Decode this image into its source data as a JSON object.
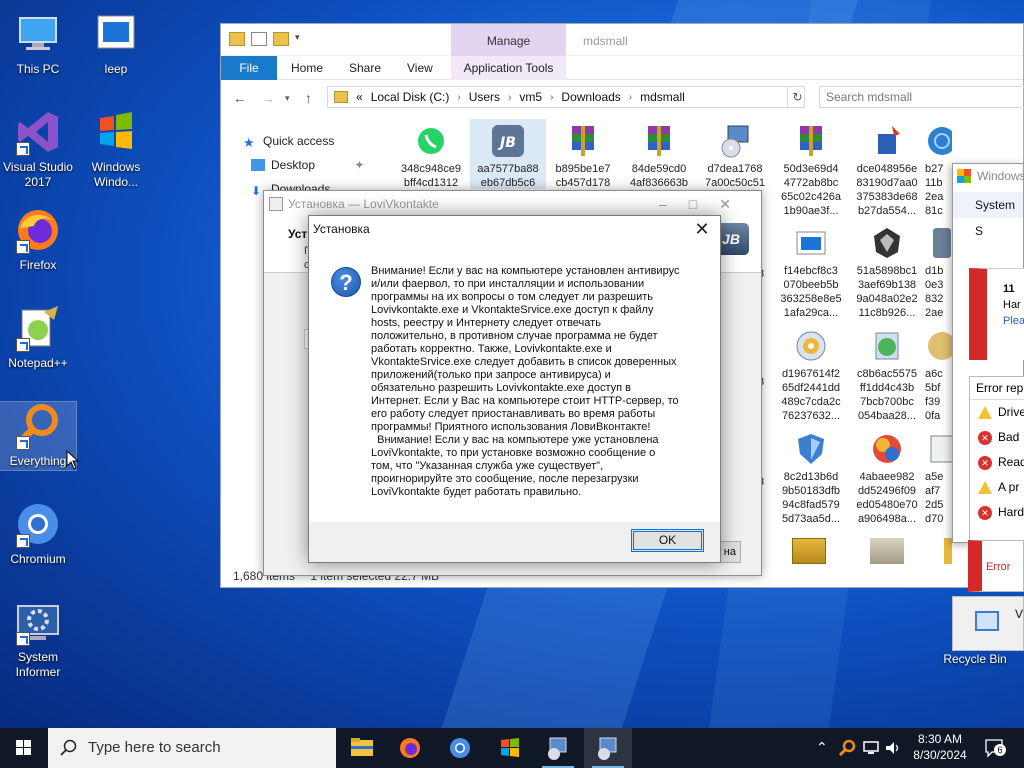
{
  "desktop": {
    "icons": [
      {
        "label": "This PC"
      },
      {
        "label": "leep"
      },
      {
        "label": "Visual Studio 2017"
      },
      {
        "label": "Windows Windo..."
      },
      {
        "label": "Firefox"
      },
      {
        "label": "Notepad++"
      },
      {
        "label": "Everything"
      },
      {
        "label": "Chromium"
      },
      {
        "label": "System Informer"
      },
      {
        "label": "Recycle Bin"
      }
    ]
  },
  "explorer": {
    "manage_tab": "Manage",
    "title": "mdsmall",
    "ribbon_tabs": [
      "File",
      "Home",
      "Share",
      "View",
      "Application Tools"
    ],
    "breadcrumb_prefix": "«",
    "breadcrumb": [
      "Local Disk (C:)",
      "Users",
      "vm5",
      "Downloads",
      "mdsmall"
    ],
    "search_placeholder": "Search mdsmall",
    "nav": {
      "quick_access": "Quick access",
      "desktop": "Desktop",
      "downloads": "Downloads"
    },
    "files": [
      {
        "l1": "348c948ce9",
        "l2": "bff4cd1312"
      },
      {
        "l1": "aa7577ba88",
        "l2": "eb67db5c6"
      },
      {
        "l1": "b895be1e7",
        "l2": "cb457d178"
      },
      {
        "l1": "84de59cd0",
        "l2": "4af836663b"
      },
      {
        "l1": "d7dea1768",
        "l2": "7a00c50c51"
      },
      {
        "l1": "50d3e69d4",
        "l2": "4772ab8bc",
        "l3": "65c02c426a",
        "l4": "1b90ae3f..."
      },
      {
        "l1": "dce048956e",
        "l2": "83190d7aa0",
        "l3": "375383de68",
        "l4": "b27da554..."
      },
      {
        "l1": "b27",
        "l2": "11b",
        "l3": "2ea",
        "l4": "81c"
      },
      {
        "l1": "f14ebcf8c3",
        "l2": "070beeb5b",
        "l3": "363258e8e5",
        "l4": "1afa29ca..."
      },
      {
        "l1": "51a5898bc1",
        "l2": "3aef69b138",
        "l3": "9a048a02e2",
        "l4": "11c8b926..."
      },
      {
        "l1": "d1b",
        "l2": "0e3",
        "l3": "832",
        "l4": "2ae"
      },
      {
        "l1": "d1967614f2",
        "l2": "65df2441dd",
        "l3": "489c7cda2c",
        "l4": "76237632..."
      },
      {
        "l1": "c8b6ac5575",
        "l2": "ff1dd4c43b",
        "l3": "7bcb700bc",
        "l4": "054baa28..."
      },
      {
        "l1": "a6c",
        "l2": "5bf",
        "l3": "f39",
        "l4": "0fa"
      },
      {
        "l1": "8c2d13b6d",
        "l2": "9b50183dfb",
        "l3": "94c8fad579",
        "l4": "5d73aa5d..."
      },
      {
        "l1": "4abaee982",
        "l2": "dd52496f09",
        "l3": "ed05480e70",
        "l4": "a906498a..."
      },
      {
        "l1": "a5e",
        "l2": "af7",
        "l3": "2d5",
        "l4": "d70"
      }
    ],
    "partial_cols": [
      "3",
      "8",
      "3",
      "a"
    ],
    "status": {
      "items": "1,680 items",
      "selected": "1 item selected  22.7 MB"
    }
  },
  "installer": {
    "title": "Установка — LoviVkontakte",
    "head_title": "Уст",
    "head_sub1": "П",
    "head_sub2": "с",
    "logo_text": "JB",
    "button_partial": "на"
  },
  "dialog": {
    "title": "Установка",
    "message": "Внимание! Если у вас на компьютере установлен антивирус\nи/или фаервол, то при инсталляции и использовании\nпрограммы на их вопросы о том следует ли разрешить\nLovivkontakte.exe и VkontakteSrvice.exe доступ к файлу\nhosts, реестру и Интернету следует отвечать\nположительно, в противном случае программа не будет\nработать корректно. Также, Lovivkontakte.exe и\nVkontakteSrvice.exe следует добавить в список доверенных\nприложений(только при запросе антивируса) и\nобязательно разрешить Lovivkontakte.exe доступ в\nИнтернет. Если у Вас на компьютере стоит HTTP-сервер, то\nего работу следует приостанавливать во время работы\nпрограммы! Приятного использования ЛовиВконтакте!\n  Внимание! Если у вас на компьютере уже установлена\nLoviVkontakte, то при установке возможно сообщение о\nтом, что \"Указанная служба уже существует\",\nпроигнорируйте это сообщение, после перезагрузки\nLoviVkontakte будет работать правильно.",
    "ok": "OK",
    "close_glyph": "✕"
  },
  "right_windows": {
    "title": "Windows",
    "system": "System S",
    "card_num": "11 ",
    "card_l2": "Har",
    "card_l3": "Plea",
    "error_report": "Error rep",
    "rows": [
      {
        "type": "warn",
        "text": "Drive"
      },
      {
        "type": "err",
        "text": "Bad"
      },
      {
        "type": "err",
        "text": "Read"
      },
      {
        "type": "warn",
        "text": "A pr"
      },
      {
        "type": "err",
        "text": "Hard"
      }
    ],
    "error_small": "Error",
    "bottom_label": "V"
  },
  "taskbar": {
    "search_placeholder": "Type here to search",
    "time": "8:30 AM",
    "date": "8/30/2024",
    "notifications": "6"
  }
}
